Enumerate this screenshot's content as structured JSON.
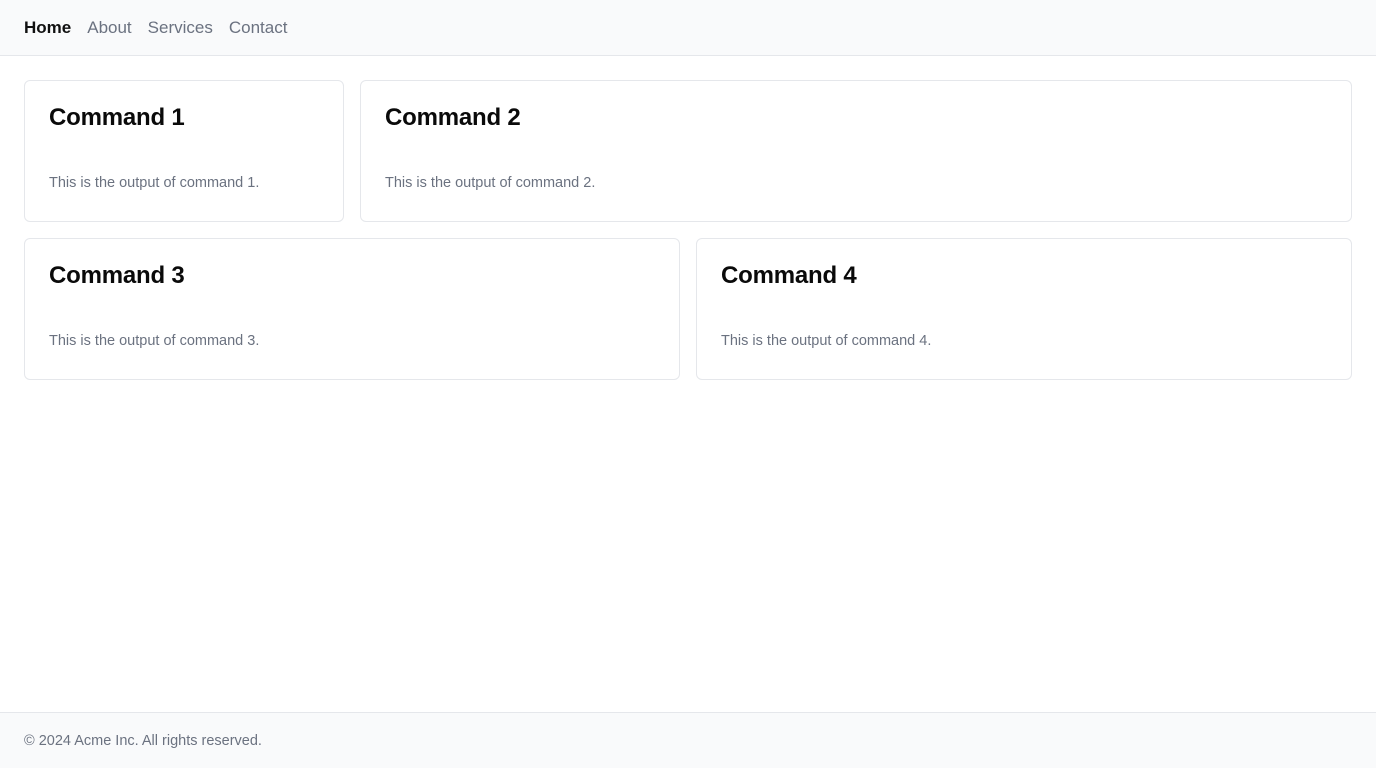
{
  "nav": {
    "items": [
      {
        "label": "Home",
        "active": true
      },
      {
        "label": "About",
        "active": false
      },
      {
        "label": "Services",
        "active": false
      },
      {
        "label": "Contact",
        "active": false
      }
    ]
  },
  "cards": [
    {
      "title": "Command 1",
      "output": "This is the output of command 1."
    },
    {
      "title": "Command 2",
      "output": "This is the output of command 2."
    },
    {
      "title": "Command 3",
      "output": "This is the output of command 3."
    },
    {
      "title": "Command 4",
      "output": "This is the output of command 4."
    }
  ],
  "footer": {
    "text": "© 2024 Acme Inc. All rights reserved."
  }
}
